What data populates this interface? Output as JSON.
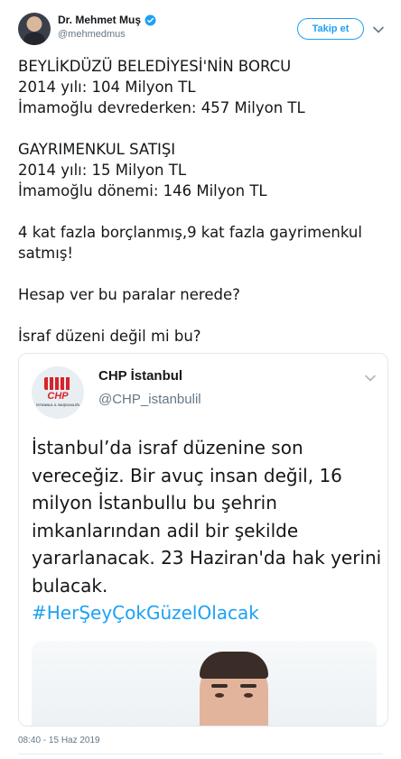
{
  "author": {
    "name": "Dr. Mehmet Muş",
    "handle": "@mehmedmus",
    "verified": true
  },
  "follow_button": {
    "label": "Takip et"
  },
  "tweet": {
    "paragraphs": [
      "BEYLİKDÜZÜ BELEDİYESİ'NİN BORCU\n2014 yılı: 104 Milyon TL\nİmamoğlu devrederken: 457 Milyon TL",
      "GAYRIMENKUL SATIŞI\n2014 yılı: 15 Milyon TL\nİmamoğlu dönemi: 146 Milyon TL",
      "4 kat fazla borçlanmış,9 kat fazla gayrimenkul satmış!",
      "Hesap ver bu paralar nerede?",
      "İsraf düzeni değil mi bu?"
    ]
  },
  "quoted_tweet": {
    "name": "CHP İstanbul",
    "handle": "@CHP_istanbulil",
    "logo_text": "CHP",
    "logo_subtext": "İSTANBUL İL BAŞKANLIĞI",
    "text": "İstanbul’da israf düzenine son vereceğiz. Bir avuç insan değil, 16 milyon İstanbullu bu şehrin imkanlarından adil bir şekilde yararlanacak. 23 Haziran'da hak yerini bulacak.",
    "hashtag": "#HerŞeyÇokGüzelOlacak"
  },
  "timestamp": "08:40 - 15 Haz 2019",
  "colors": {
    "accent": "#1da1f2",
    "secondary_text": "#657786",
    "border": "#e1e8ed",
    "chp_red": "#d8232a"
  },
  "icons": {
    "verified": "verified-badge-icon",
    "caret": "chevron-down-icon"
  }
}
